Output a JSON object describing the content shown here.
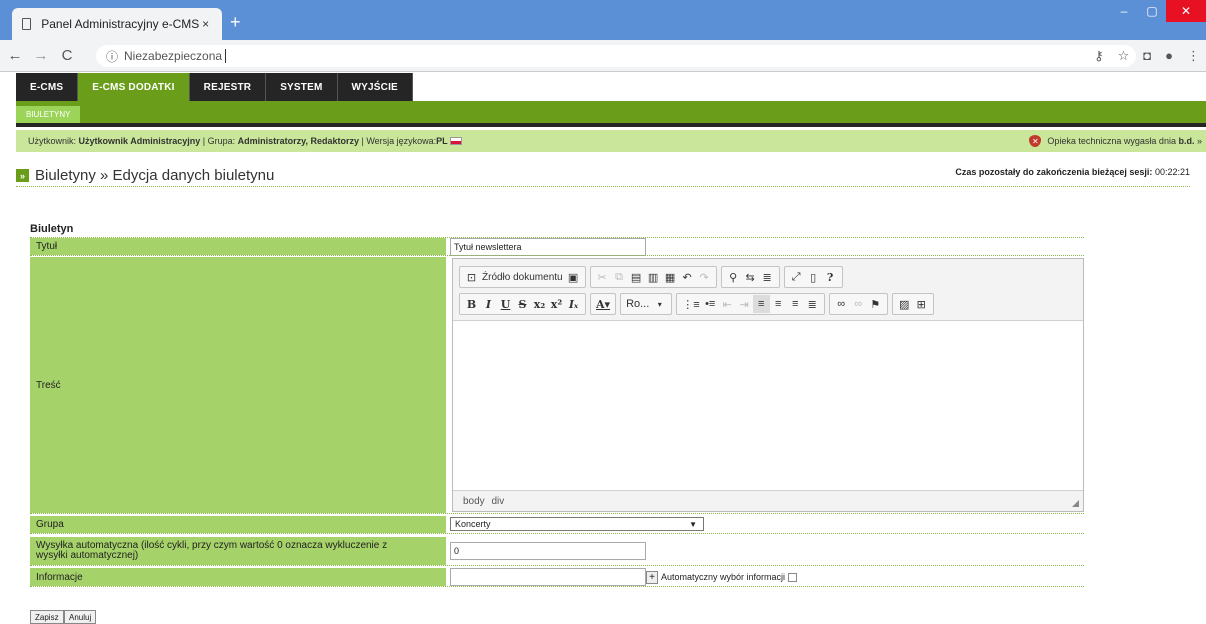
{
  "browser": {
    "tab_title": "Panel Administracyjny e-CMS",
    "tab_close": "×",
    "new_tab": "+",
    "address_security": "Niezabezpieczona",
    "win_min": "–",
    "win_max": "▢",
    "win_close": "✕"
  },
  "mainmenu": {
    "items": [
      "E-CMS",
      "E-CMS DODATKI",
      "REJESTR",
      "SYSTEM",
      "WYJŚCIE"
    ],
    "active_index": 1
  },
  "submenu": {
    "item": "BIULETYNY"
  },
  "infobar": {
    "user_label": "Użytkownik:",
    "user_value": "Użytkownik Administracyjny",
    "group_label": "Grupa:",
    "group_value": "Administratorzy, Redaktorzy",
    "lang_label": "Wersja językowa:",
    "lang_value": "PL",
    "support_text": "Opieka techniczna wygasła dnia",
    "support_value": "b.d.",
    "support_suffix": "»"
  },
  "heading": {
    "text": "Biuletyny » Edycja danych biuletynu",
    "session_label": "Czas pozostały do zakończenia bieżącej sesji:",
    "session_value": "00:22:21"
  },
  "form": {
    "section_title": "Biuletyn",
    "title_label": "Tytuł",
    "title_value": "Tytuł newslettera",
    "content_label": "Treść",
    "group_label": "Grupa",
    "group_value": "Koncerty",
    "auto_label": "Wysyłka automatyczna (ilość cykli, przy czym wartość 0 oznacza wykluczenie z wysyłki automatycznej)",
    "auto_value": "0",
    "info_label": "Informacje",
    "info_value": "",
    "info_add": "+",
    "info_auto_label": "Automatyczny wybór informacji"
  },
  "editor": {
    "source_label": "Źródło dokumentu",
    "font_combo": "Ro...",
    "path": "body div"
  },
  "buttons": {
    "save": "Zapisz",
    "cancel": "Anuluj"
  }
}
